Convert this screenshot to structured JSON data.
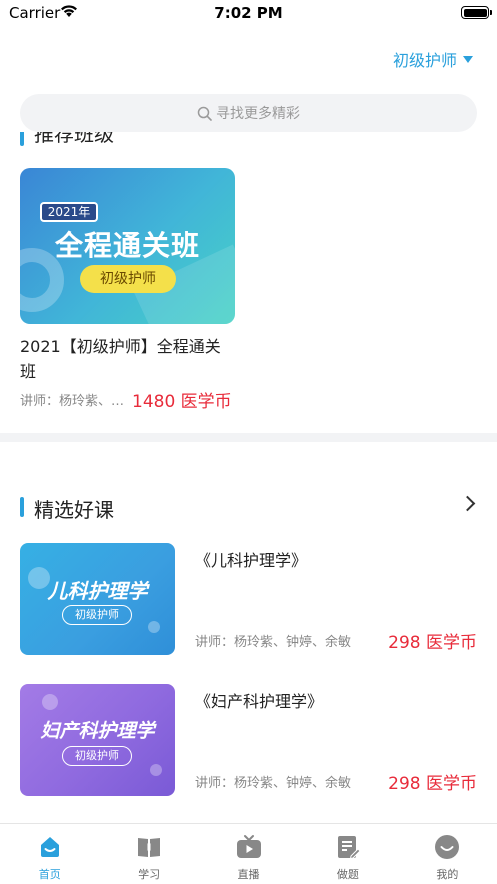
{
  "status_bar": {
    "carrier": "Carrier",
    "time": "7:02 PM"
  },
  "header": {
    "level_label": "初级护师"
  },
  "search": {
    "placeholder": "寻找更多精彩"
  },
  "recommend": {
    "heading": "推荐班级",
    "card": {
      "thumb_year": "2021年",
      "thumb_title": "全程通关班",
      "thumb_tag": "初级护师",
      "title": "2021【初级护师】全程通关班",
      "teacher": "讲师：杨玲紫、钟婷",
      "price": "1480 医学币"
    }
  },
  "selected": {
    "title": "精选好课",
    "courses": [
      {
        "thumb_title": "儿科护理学",
        "thumb_tag": "初级护师",
        "title": "《儿科护理学》",
        "teacher": "讲师：杨玲紫、钟婷、余敏",
        "price": "298 医学币"
      },
      {
        "thumb_title": "妇产科护理学",
        "thumb_tag": "初级护师",
        "title": "《妇产科护理学》",
        "teacher": "讲师：杨玲紫、钟婷、余敏",
        "price": "298 医学币"
      }
    ]
  },
  "tabbar": {
    "items": [
      {
        "label": "首页",
        "icon": "home-icon",
        "active": true
      },
      {
        "label": "学习",
        "icon": "book-icon",
        "active": false
      },
      {
        "label": "直播",
        "icon": "tv-icon",
        "active": false
      },
      {
        "label": "做题",
        "icon": "exam-icon",
        "active": false
      },
      {
        "label": "我的",
        "icon": "profile-icon",
        "active": false
      }
    ]
  },
  "colors": {
    "accent": "#2aa0dc",
    "price": "#e82b3a"
  }
}
